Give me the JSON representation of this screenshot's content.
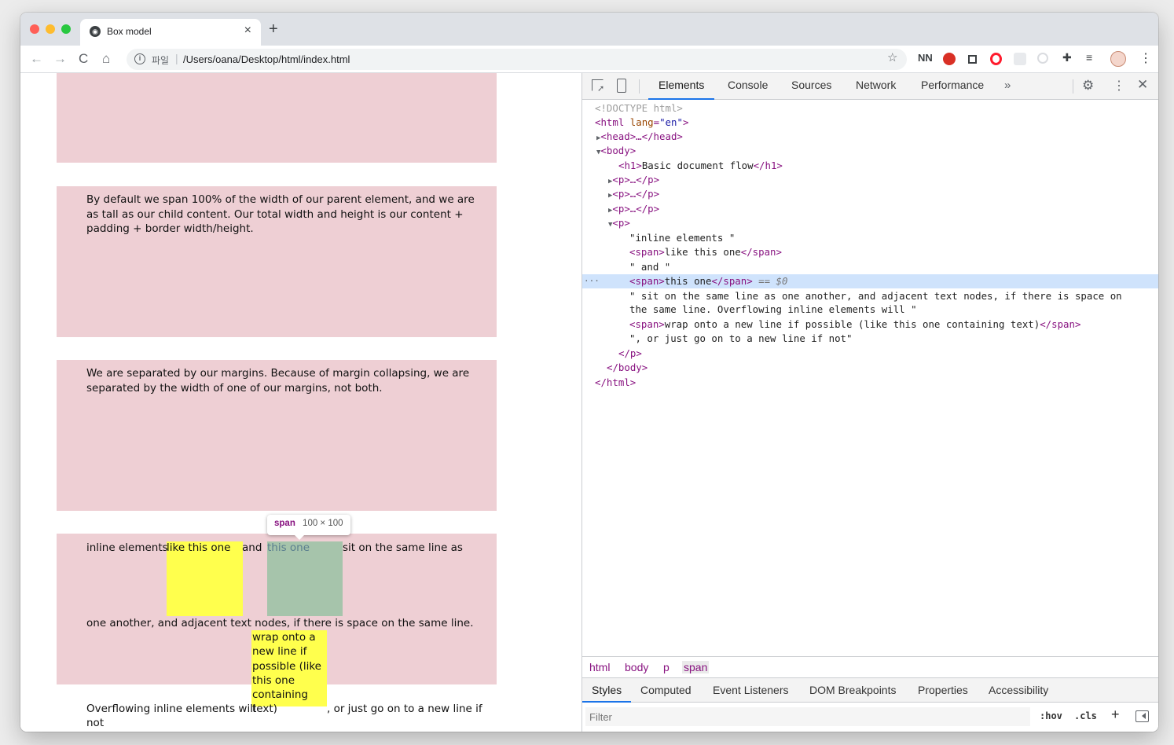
{
  "browser": {
    "tab_title": "Box model",
    "tab_close": "×",
    "new_tab": "+",
    "nav": {
      "back": "←",
      "forward": "→",
      "reload": "C",
      "home": "⌂"
    },
    "omnibox": {
      "info": "i",
      "scheme_label": "파일",
      "separator": "|",
      "url": "/Users/oana/Desktop/html/index.html"
    },
    "star": "☆",
    "extensions": {
      "nn": "NN",
      "puzzle": "✚",
      "playlist": "≡",
      "menu": "⋮"
    }
  },
  "page": {
    "paragraph_1": "By default we span 100% of the width of our parent element, and we are as tall as our child content. Our total width and height is our content + padding + border width/height.",
    "paragraph_2": "We are separated by our margins. Because of margin collapsing, we are separated by the width of one of our margins, not both.",
    "inline": {
      "text_1": "inline elements ",
      "span_1": "like this one",
      "text_and": " and ",
      "span_2": "this one",
      "text_2": " sit on the same line as",
      "text_3": "one another, and adjacent text nodes, if there is space on the same line.",
      "text_4": "Overflowing inline elements will ",
      "wrap_span": "wrap onto a new line if possible (like this one containing text)",
      "text_5": ", or just go on to a new line if",
      "text_6": "not"
    },
    "tooltip": {
      "tag": "span",
      "size": "100 × 100"
    }
  },
  "devtools": {
    "tabs": [
      "Elements",
      "Console",
      "Sources",
      "Network",
      "Performance"
    ],
    "more": "»",
    "gear": "⚙",
    "kebab": "⋮",
    "close": "✕",
    "dom": {
      "doctype": "<!DOCTYPE html>",
      "html_open": "<html",
      "lang_attr": "lang",
      "lang_val": "\"en\"",
      "head": "<head>…</head>",
      "body_open": "<body>",
      "h1": "<h1>",
      "h1_text": "Basic document flow",
      "h1_close": "</h1>",
      "p_collapsed": "<p>…</p>",
      "p_open": "<p>",
      "t1": "\"inline elements \"",
      "span_open": "<span>",
      "span_close": "</span>",
      "like_this_one": "like this one",
      "t_and": "\" and \"",
      "this_one": "this one",
      "eq0": " == $0",
      "sel_dots": "···",
      "t_sit_1": "\" sit on the same line as one another, and adjacent text nodes, if there is space on",
      "t_sit_2": "the same line. Overflowing inline elements will \"",
      "wrap_text": "wrap onto a new line if possible (like this one containing text)",
      "t_last": "\", or just go on to a new line if not\"",
      "p_close": "</p>",
      "body_close": "</body>",
      "html_close": "</html>"
    },
    "breadcrumbs": [
      "html",
      "body",
      "p",
      "span"
    ],
    "sub_tabs": [
      "Styles",
      "Computed",
      "Event Listeners",
      "DOM Breakpoints",
      "Properties",
      "Accessibility"
    ],
    "filter_placeholder": "Filter",
    "hov": ":hov",
    "cls": ".cls",
    "plus": "+"
  }
}
